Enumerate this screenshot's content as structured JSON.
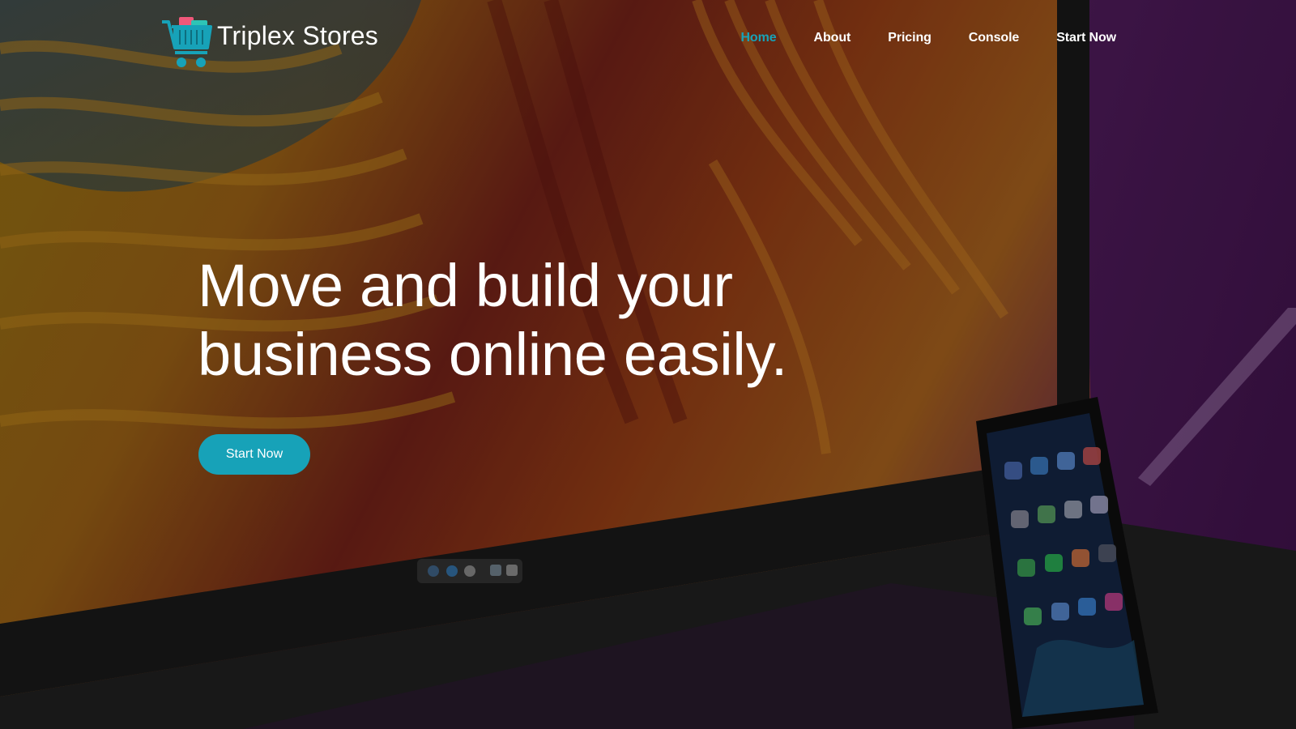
{
  "brand": {
    "name": "Triplex Stores",
    "logo_icon": "shopping-cart-icon"
  },
  "nav": {
    "items": [
      {
        "label": "Home",
        "active": true
      },
      {
        "label": "About",
        "active": false
      },
      {
        "label": "Pricing",
        "active": false
      },
      {
        "label": "Console",
        "active": false
      },
      {
        "label": "Start Now",
        "active": false
      }
    ]
  },
  "hero": {
    "headline_line1": "Move and build your",
    "headline_line2": "business online easily.",
    "cta_label": "Start Now"
  },
  "colors": {
    "accent": "#17a2b8",
    "text": "#ffffff",
    "logo_pink": "#f0587a"
  }
}
